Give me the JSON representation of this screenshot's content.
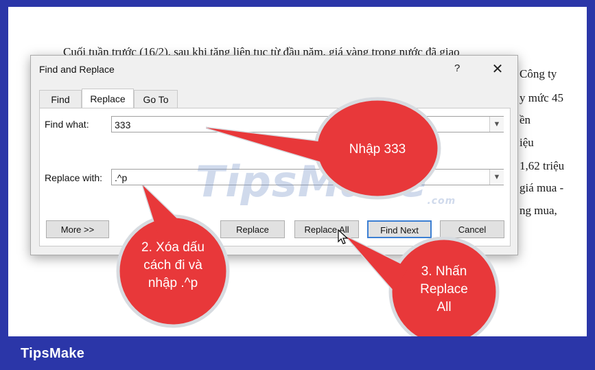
{
  "document": {
    "lines": [
      "Cuối tuần trước (16/2), sau khi tăng liên tục từ đầu năm, giá vàng trong nước đã giao",
      "Công ty",
      "y mức 45",
      "ền",
      "iệu",
      "1,62 triệu",
      "giá mua -",
      "ng mua,"
    ]
  },
  "dialog": {
    "title": "Find and Replace",
    "help_glyph": "?",
    "close_glyph": "✕",
    "tabs": [
      {
        "label": "Find",
        "active": false
      },
      {
        "label": "Replace",
        "active": true
      },
      {
        "label": "Go To",
        "active": false
      }
    ],
    "find_label": "Find what:",
    "find_value": "333",
    "replace_label": "Replace with:",
    "replace_value": ".^p",
    "buttons": {
      "more": "More >>",
      "replace": "Replace",
      "replace_all": "Replace All",
      "find_next": "Find Next",
      "cancel": "Cancel"
    }
  },
  "watermark": {
    "text": "TipsMake",
    "suffix": ".com"
  },
  "callouts": {
    "step1": "Nhập 333",
    "step2": [
      "2. Xóa dấu",
      "cách đi và",
      "nhập .^p"
    ],
    "step3": [
      "3. Nhấn",
      "Replace",
      "All"
    ]
  },
  "footer": {
    "brand": "TipsMake"
  },
  "colors": {
    "frame_blue": "#2b36a8",
    "callout_red": "#e8383a",
    "callout_border": "#d7dbe0",
    "primary_button_border": "#3c7fd3"
  }
}
